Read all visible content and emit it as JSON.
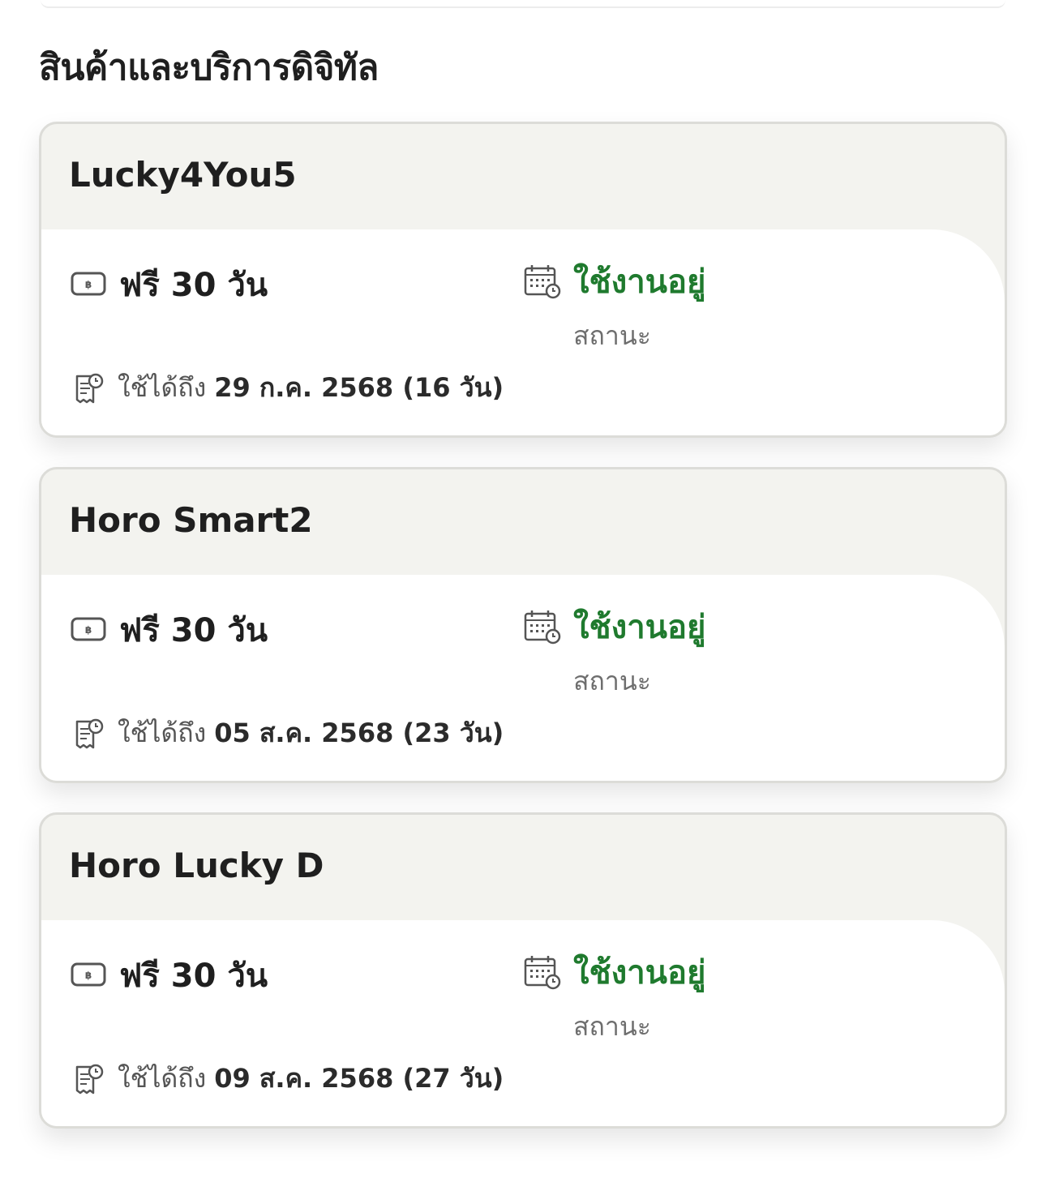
{
  "page": {
    "section_title": "สินค้าและบริการดิจิทัล"
  },
  "colors": {
    "status_active": "#1f7a2e",
    "card_header_bg": "#f3f3ef",
    "card_border": "#dcdcd8"
  },
  "icons": {
    "price": "baht-tag-icon",
    "status": "calendar-clock-icon",
    "expiry": "receipt-clock-icon"
  },
  "services": [
    {
      "name": "Lucky4You5",
      "price_label": "ฟรี 30 วัน",
      "status": "ใช้งานอยู่",
      "status_caption": "สถานะ",
      "expire_label": "ใช้ได้ถึง",
      "expire_date": "29 ก.ค. 2568 (16 วัน)"
    },
    {
      "name": "Horo Smart2",
      "price_label": "ฟรี 30 วัน",
      "status": "ใช้งานอยู่",
      "status_caption": "สถานะ",
      "expire_label": "ใช้ได้ถึง",
      "expire_date": "05 ส.ค. 2568 (23 วัน)"
    },
    {
      "name": "Horo Lucky D",
      "price_label": "ฟรี 30 วัน",
      "status": "ใช้งานอยู่",
      "status_caption": "สถานะ",
      "expire_label": "ใช้ได้ถึง",
      "expire_date": "09 ส.ค. 2568 (27 วัน)"
    }
  ]
}
